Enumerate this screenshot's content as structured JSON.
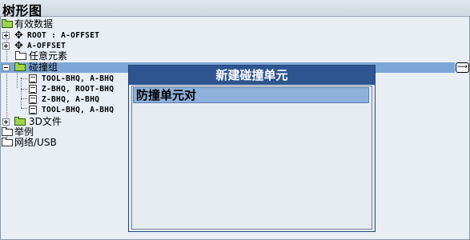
{
  "window": {
    "title": "树形图"
  },
  "tree": {
    "root_folder": "有效数据",
    "n1": "ROOT : A-OFFSET",
    "n2": "A-OFFSET",
    "n3": "任意元素",
    "n4": "碰撞组",
    "c1": "TOOL-BHQ, A-BHQ",
    "c2": "Z-BHQ, ROOT-BHQ",
    "c3": "Z-BHQ, A-BHQ",
    "c4": "TOOL-BHQ, A-BHQ",
    "n5": "3D文件",
    "ex": "举例",
    "net": "网络/USB"
  },
  "dialog": {
    "title": "新建碰撞单元",
    "item": "防撞单元对"
  }
}
